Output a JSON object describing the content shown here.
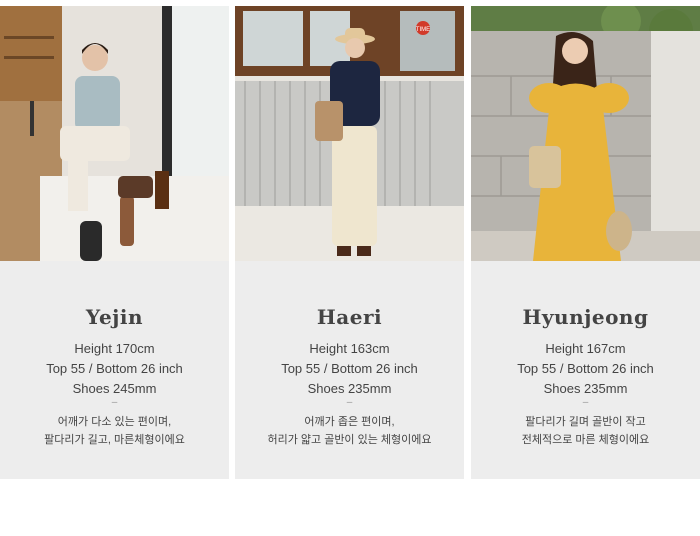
{
  "models": [
    {
      "name": "Yejin",
      "height": "Height 170cm",
      "sizes": "Top 55 / Bottom 26 inch",
      "shoes": "Shoes  245mm",
      "divider": "–",
      "desc_line1": "어깨가 다소 있는 편이며,",
      "desc_line2": "팔다리가 길고, 마른체형이에요"
    },
    {
      "name": "Haeri",
      "height": "Height 163cm",
      "sizes": "Top 55 / Bottom 26 inch",
      "shoes": "Shoes  235mm",
      "divider": "–",
      "desc_line1": "어깨가 좁은 편이며,",
      "desc_line2": "허리가 얇고 골반이 있는 체형이에요"
    },
    {
      "name": "Hyunjeong",
      "height": "Height 167cm",
      "sizes": "Top 55 / Bottom 26 inch",
      "shoes": "Shoes  235mm",
      "divider": "–",
      "desc_line1": "팔다리가 길며 골반이 작고",
      "desc_line2": "전체적으로 마른 체형이에요"
    }
  ],
  "photo_signs": {
    "cafe_sign": "TIME"
  }
}
